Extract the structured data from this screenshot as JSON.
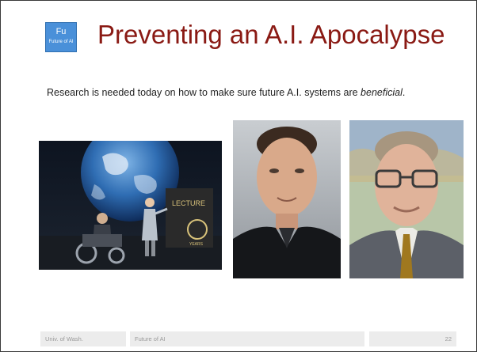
{
  "slide": {
    "logo": {
      "main": "Fu",
      "sub": "Future of AI"
    },
    "title": "Preventing an A.I. Apocalypse",
    "body": {
      "text_before": "Research is needed today on how to make sure future A.I. systems are ",
      "emphasis": "beneficial",
      "text_after": "."
    },
    "photos": {
      "hawking": {
        "signage": "LECTURE",
        "caption": "YEARS"
      }
    }
  },
  "footer": {
    "left": "Univ. of Wash.",
    "center": "Future of AI",
    "page_number": "22"
  }
}
